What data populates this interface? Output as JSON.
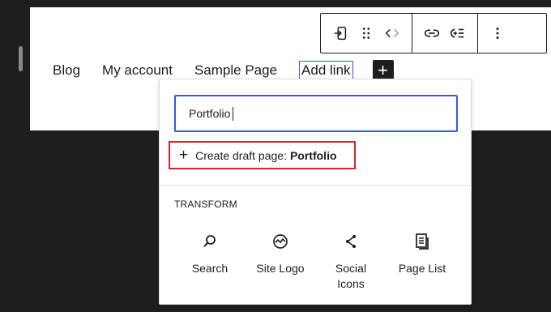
{
  "navigation": {
    "items": [
      "Blog",
      "My account",
      "Sample Page",
      "Add link"
    ],
    "add_block_icon": "plus-icon"
  },
  "toolbar": {
    "buttons": [
      "transform-block-icon",
      "drag-handle-icon",
      "move-arrows-icon",
      "link-icon",
      "indent-submenu-icon",
      "more-options-icon"
    ]
  },
  "link_popover": {
    "search_value": "Portfolio",
    "create_draft_prefix": "Create draft page:",
    "create_draft_name": "Portfolio",
    "transform": {
      "title": "TRANSFORM",
      "options": [
        {
          "label": "Search",
          "icon": "search-icon"
        },
        {
          "label": "Site Logo",
          "icon": "site-logo-icon"
        },
        {
          "label": "Social Icons",
          "icon": "share-icon"
        },
        {
          "label": "Page List",
          "icon": "page-list-icon"
        }
      ]
    }
  },
  "colors": {
    "accent": "#3858e9",
    "highlight_box": "#d0272b",
    "background": "#1e1e1e"
  }
}
